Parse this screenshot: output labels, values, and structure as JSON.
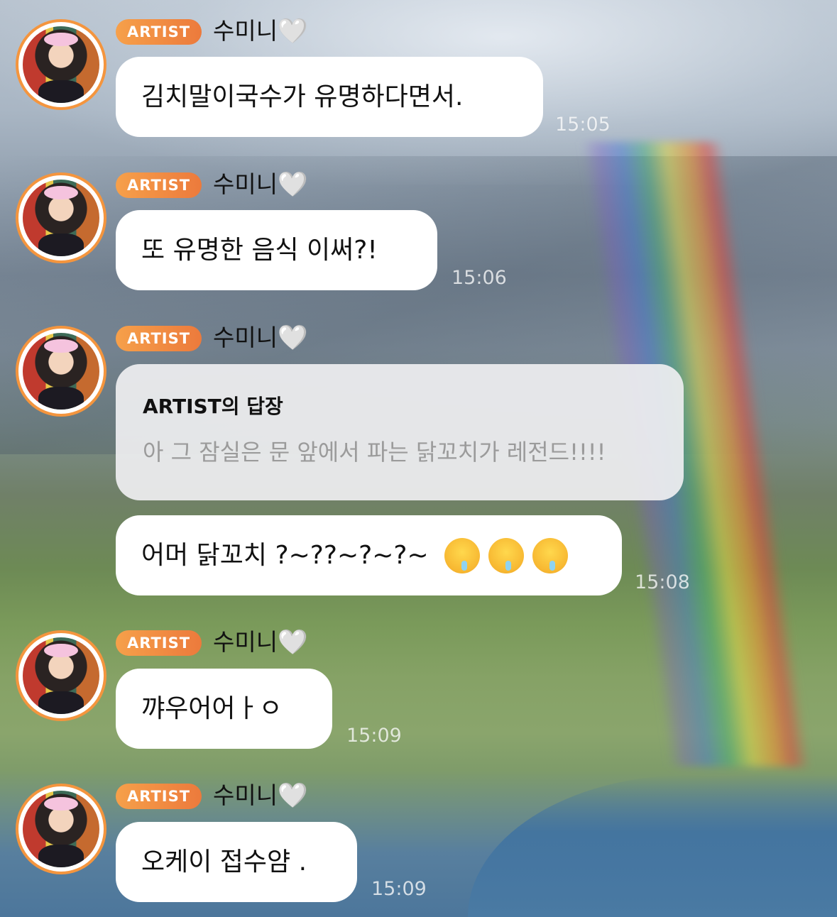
{
  "messages": [
    {
      "badge": "ARTIST",
      "name": "수미니",
      "heart": "🤍",
      "text": "김치말이국수가 유명하다면서.",
      "time": "15:05"
    },
    {
      "badge": "ARTIST",
      "name": "수미니",
      "heart": "🤍",
      "text": "또 유명한 음식 이써?!",
      "time": "15:06"
    },
    {
      "badge": "ARTIST",
      "name": "수미니",
      "heart": "🤍",
      "reply": {
        "title": "ARTIST의 답장",
        "text": "아 그 잠실은 문 앞에서 파는 닭꼬치가 레전드!!!!"
      },
      "text": "어머 닭꼬치 ?~??~?~?~",
      "emojis": [
        "drooling-face",
        "drooling-face",
        "drooling-face"
      ],
      "time": "15:08"
    },
    {
      "badge": "ARTIST",
      "name": "수미니",
      "heart": "🤍",
      "text": "꺄우어어ㅏㅇ",
      "time": "15:09"
    },
    {
      "badge": "ARTIST",
      "name": "수미니",
      "heart": "🤍",
      "text": "오케이 접수얌 .",
      "time": "15:09"
    }
  ],
  "colors": {
    "badge": "#f08a3f",
    "avatar_ring": "#f4953e",
    "bubble": "#ffffff"
  }
}
